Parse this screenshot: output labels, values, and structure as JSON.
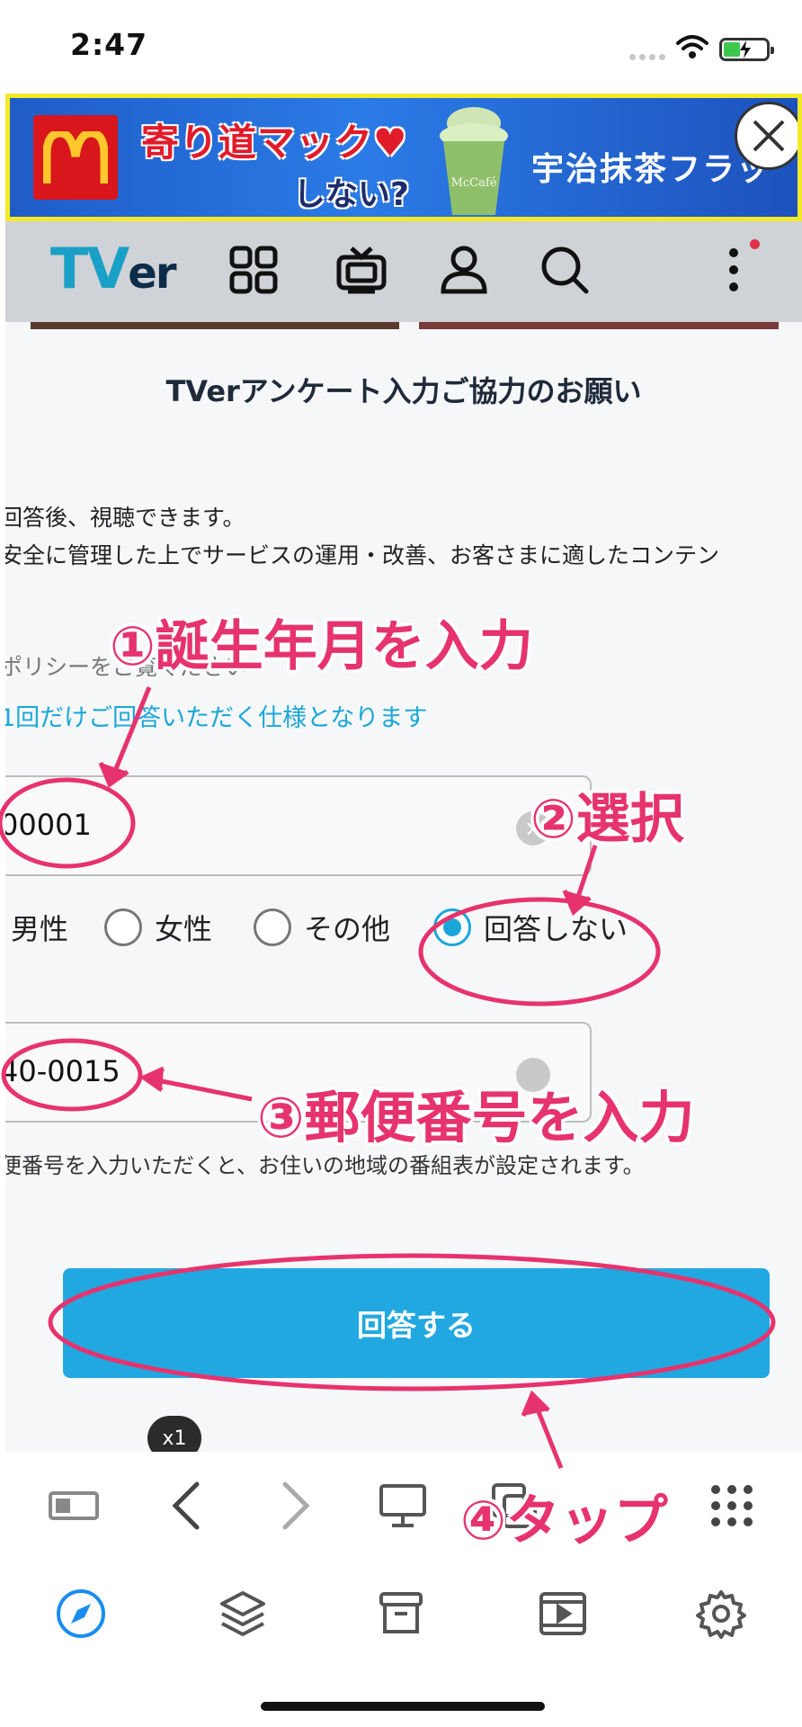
{
  "status_bar": {
    "time": "2:47"
  },
  "ad": {
    "headline": "寄り道マック♥",
    "sub": "しない?",
    "drink_label": "McCafé",
    "product": "宇治抹茶フラッ",
    "brand_color": "#d8161c",
    "border_color": "#f3ea27"
  },
  "nav": {
    "logo": "TV",
    "logo_suffix": "er",
    "icons": [
      "grid-icon",
      "tv-icon",
      "profile-icon",
      "search-icon",
      "more-vertical-icon"
    ]
  },
  "survey": {
    "title": "TVerアンケート入力ご協力のお願い",
    "intro_line1": "回答後、視聴できます。",
    "intro_line2": "安全に管理した上でサービスの運用・改善、お客さまに適したコンテン",
    "policy_text": "ポリシーをご覧ください",
    "once_note": "1回だけご回答いただく仕様となります",
    "birth_value": "00001",
    "gender_options": [
      {
        "label": "男性",
        "selected": false
      },
      {
        "label": "女性",
        "selected": false
      },
      {
        "label": "その他",
        "selected": false
      },
      {
        "label": "回答しない",
        "selected": true
      }
    ],
    "zip_value": "40-0015",
    "zip_note": "便番号を入力いただくと、お住いの地域の番組表が設定されます。",
    "submit_label": "回答する",
    "accent_color": "#22a8e0"
  },
  "speed_badge": "x1",
  "annotations": {
    "step1": "①誕生年月を入力",
    "step2": "②選択",
    "step3": "③郵便番号を入力",
    "step4": "④タップ",
    "color": "#e6336e"
  },
  "toolbar": {
    "icons": [
      "reader-mode-icon",
      "back-icon",
      "forward-icon",
      "desktop-icon",
      "tabs-icon",
      "apps-grid-icon"
    ]
  },
  "tabbar": {
    "icons": [
      "compass-icon",
      "layers-icon",
      "archive-icon",
      "video-icon",
      "settings-icon"
    ],
    "active_color": "#1a8cf0"
  }
}
